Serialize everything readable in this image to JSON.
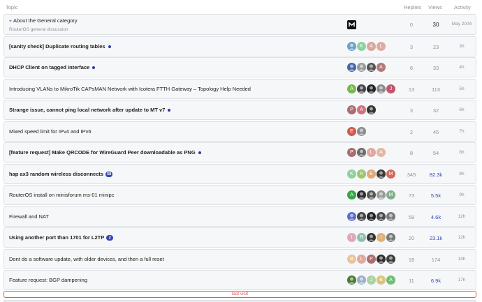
{
  "header": {
    "topic": "Topic",
    "replies": "Replies",
    "views": "Views",
    "activity": "Activity"
  },
  "colors": {
    "accent": "#3447b4",
    "row_bg": "#f6f7f9",
    "last_visit": "#e45757"
  },
  "topics": [
    {
      "title": "About the General category",
      "pinned": true,
      "subtitle": "RouterOS general discussion",
      "bold": false,
      "unread_dot": false,
      "badge": "",
      "posters": [
        {
          "letter": "",
          "color": "#111111",
          "icon": "mikrotik-logo"
        }
      ],
      "replies": "0",
      "views": "30",
      "views_style": "dark",
      "activity": "May 2004"
    },
    {
      "title": "[sanity check] Duplicate routing tables",
      "bold": true,
      "unread_dot": true,
      "badge": "",
      "posters": [
        {
          "letter": "",
          "color": "#6aa1c9",
          "icon": "photo-avatar"
        },
        {
          "letter": "K",
          "color": "#8fd19e"
        },
        {
          "letter": "A",
          "color": "#d8a7a0"
        },
        {
          "letter": "L",
          "color": "#e0a9a1"
        }
      ],
      "replies": "3",
      "views": "23",
      "views_style": "",
      "activity": "3h"
    },
    {
      "title": "DHCP Client on tagged interface",
      "bold": true,
      "unread_dot": true,
      "badge": "",
      "posters": [
        {
          "letter": "",
          "color": "#4766a8",
          "icon": "photo-avatar"
        },
        {
          "letter": "",
          "color": "#9a9a9a",
          "icon": "photo-avatar"
        },
        {
          "letter": "",
          "color": "#555555",
          "icon": "photo-avatar"
        },
        {
          "letter": "A",
          "color": "#b27a78"
        }
      ],
      "replies": "6",
      "views": "33",
      "views_style": "",
      "activity": "4h"
    },
    {
      "title": "Introducing VLANs to MikroTik CAPsMAN Network with Icotera FTTH Gateway – Topology Help Needed",
      "bold": false,
      "unread_dot": false,
      "badge": "",
      "posters": [
        {
          "letter": "A",
          "color": "#78b84f"
        },
        {
          "letter": "",
          "color": "#444444",
          "icon": "photo-avatar"
        },
        {
          "letter": "",
          "color": "#222222",
          "icon": "photo-avatar"
        },
        {
          "letter": "",
          "color": "#888888",
          "icon": "photo-avatar"
        },
        {
          "letter": "J",
          "color": "#c2576b"
        }
      ],
      "replies": "13",
      "views": "113",
      "views_style": "",
      "activity": "5h"
    },
    {
      "title": "Strange issue, cannot ping local network after update to MT v7",
      "bold": true,
      "unread_dot": true,
      "badge": "",
      "posters": [
        {
          "letter": "P",
          "color": "#a96e6e"
        },
        {
          "letter": "A",
          "color": "#d0707a"
        },
        {
          "letter": "",
          "color": "#333333",
          "icon": "photo-avatar"
        }
      ],
      "replies": "3",
      "views": "32",
      "views_style": "",
      "activity": "6h"
    },
    {
      "title": "Mixed speed limit for IPv4 and IPv6",
      "bold": false,
      "unread_dot": false,
      "badge": "",
      "posters": [
        {
          "letter": "E",
          "color": "#d25a4e"
        },
        {
          "letter": "",
          "color": "#8c8c8c",
          "icon": "photo-avatar"
        }
      ],
      "replies": "2",
      "views": "45",
      "views_style": "",
      "activity": "7h"
    },
    {
      "title": "[feature request] Make QRCODE for WireGuard Peer downloadable as PNG",
      "bold": true,
      "unread_dot": true,
      "badge": "",
      "posters": [
        {
          "letter": "P",
          "color": "#a96e6e"
        },
        {
          "letter": "",
          "color": "#6b6b6b",
          "icon": "photo-avatar"
        },
        {
          "letter": "L",
          "color": "#e0a9a1"
        },
        {
          "letter": "A",
          "color": "#e3b7a3"
        }
      ],
      "replies": "8",
      "views": "54",
      "views_style": "",
      "activity": "8h"
    },
    {
      "title": "hap ax3 random wireless disconnects",
      "bold": true,
      "unread_dot": false,
      "badge": "58",
      "posters": [
        {
          "letter": "K",
          "color": "#8fd19e"
        },
        {
          "letter": "R",
          "color": "#9dc56b"
        },
        {
          "letter": "E",
          "color": "#e4a874"
        },
        {
          "letter": "",
          "color": "#3a3a3a",
          "icon": "photo-avatar"
        },
        {
          "letter": "M",
          "color": "#d4695e"
        }
      ],
      "replies": "345",
      "views": "82.3k",
      "views_style": "hot",
      "activity": "8h"
    },
    {
      "title": "RouterOS install on minisforum ms-01 minipc",
      "bold": false,
      "unread_dot": false,
      "badge": "",
      "posters": [
        {
          "letter": "A",
          "color": "#3ba34a"
        },
        {
          "letter": "",
          "color": "#2c2c2c",
          "icon": "photo-avatar"
        },
        {
          "letter": "",
          "color": "#555555",
          "icon": "photo-avatar"
        },
        {
          "letter": "",
          "color": "#999999",
          "icon": "photo-avatar"
        },
        {
          "letter": "M",
          "color": "#86ad8a"
        }
      ],
      "replies": "73",
      "views": "5.5k",
      "views_style": "hot",
      "activity": "9h"
    },
    {
      "title": "Firewall and NAT",
      "bold": false,
      "unread_dot": false,
      "badge": "",
      "posters": [
        {
          "letter": "",
          "color": "#5c6ec7",
          "icon": "photo-avatar"
        },
        {
          "letter": "",
          "color": "#444444",
          "icon": "photo-avatar"
        },
        {
          "letter": "",
          "color": "#222222",
          "icon": "photo-avatar"
        },
        {
          "letter": "",
          "color": "#4a4a4a",
          "icon": "photo-avatar"
        },
        {
          "letter": "",
          "color": "#7a7a7a",
          "icon": "photo-avatar"
        }
      ],
      "replies": "59",
      "views": "4.6k",
      "views_style": "hot",
      "activity": "12h"
    },
    {
      "title": "Using another port than 1701 for L2TP",
      "bold": true,
      "unread_dot": false,
      "badge": "2",
      "posters": [
        {
          "letter": "I",
          "color": "#e0a9b6"
        },
        {
          "letter": "R",
          "color": "#8fbfb0"
        },
        {
          "letter": "",
          "color": "#333333",
          "icon": "photo-avatar"
        },
        {
          "letter": "I",
          "color": "#e0b27a"
        },
        {
          "letter": "",
          "color": "#777777",
          "icon": "photo-avatar"
        }
      ],
      "replies": "20",
      "views": "23.1k",
      "views_style": "hot",
      "activity": "12h"
    },
    {
      "title": "Dont do a software update, with older devices, and then a full reset",
      "bold": false,
      "unread_dot": false,
      "badge": "",
      "posters": [
        {
          "letter": "B",
          "color": "#e9c39a"
        },
        {
          "letter": "L",
          "color": "#e0a9a1"
        },
        {
          "letter": "P",
          "color": "#a96e6e"
        },
        {
          "letter": "",
          "color": "#2e2e2e",
          "icon": "photo-avatar"
        },
        {
          "letter": "",
          "color": "#3d3d3d",
          "icon": "photo-avatar"
        }
      ],
      "replies": "18",
      "views": "174",
      "views_style": "",
      "activity": "14h"
    },
    {
      "title": "Feature request: BGP dampening",
      "bold": false,
      "unread_dot": false,
      "badge": "",
      "posters": [
        {
          "letter": "",
          "color": "#4a7a3a",
          "icon": "photo-avatar"
        },
        {
          "letter": "",
          "color": "#9ab0c8",
          "icon": "photo-avatar"
        },
        {
          "letter": "J",
          "color": "#a9d3a3"
        },
        {
          "letter": "B",
          "color": "#d9c47a"
        },
        {
          "letter": "A",
          "color": "#6fbf73"
        }
      ],
      "replies": "11",
      "views": "6.9k",
      "views_style": "hot",
      "activity": "17h"
    }
  ],
  "last_visit": "last visit"
}
